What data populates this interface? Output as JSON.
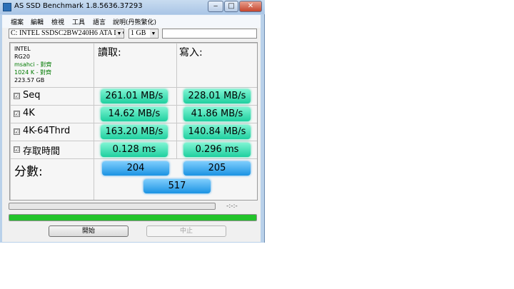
{
  "window": {
    "title": "AS SSD Benchmark 1.8.5636.37293",
    "minimize_symbol": "‒",
    "maximize_symbol": "□",
    "close_symbol": "✕"
  },
  "menu": [
    "檔案",
    "編輯",
    "檢視",
    "工具",
    "語言",
    "說明(丹熊繁化)"
  ],
  "toolbar": {
    "drive": "C: INTEL SSDSC2BW240H6 ATA Device",
    "size": "1 GB",
    "extra": ""
  },
  "drive_info": {
    "name": "INTEL",
    "firmware": "RG20",
    "driver_status": "msahci - 對齊",
    "alignment_status": "1024 K - 對齊",
    "capacity": "223.57 GB"
  },
  "headers": {
    "read": "讀取:",
    "write": "寫入:"
  },
  "tests": [
    {
      "label": "Seq",
      "checkbox": "☑",
      "read": "261.01 MB/s",
      "write": "228.01 MB/s"
    },
    {
      "label": "4K",
      "checkbox": "☑",
      "read": "14.62 MB/s",
      "write": "41.86 MB/s"
    },
    {
      "label": "4K-64Thrd",
      "checkbox": "☑",
      "read": "163.20 MB/s",
      "write": "140.84 MB/s"
    },
    {
      "label": "存取時間",
      "checkbox": "☑",
      "read": "0.128 ms",
      "write": "0.296 ms"
    }
  ],
  "score": {
    "label": "分數:",
    "read": "204",
    "write": "205",
    "total": "517"
  },
  "progress": {
    "time": "-:-:-",
    "bar1_fraction": 0.0,
    "bar2_fraction": 1.0,
    "bar2_color": "#22c32a"
  },
  "buttons": {
    "start": "開始",
    "stop": "中止"
  }
}
